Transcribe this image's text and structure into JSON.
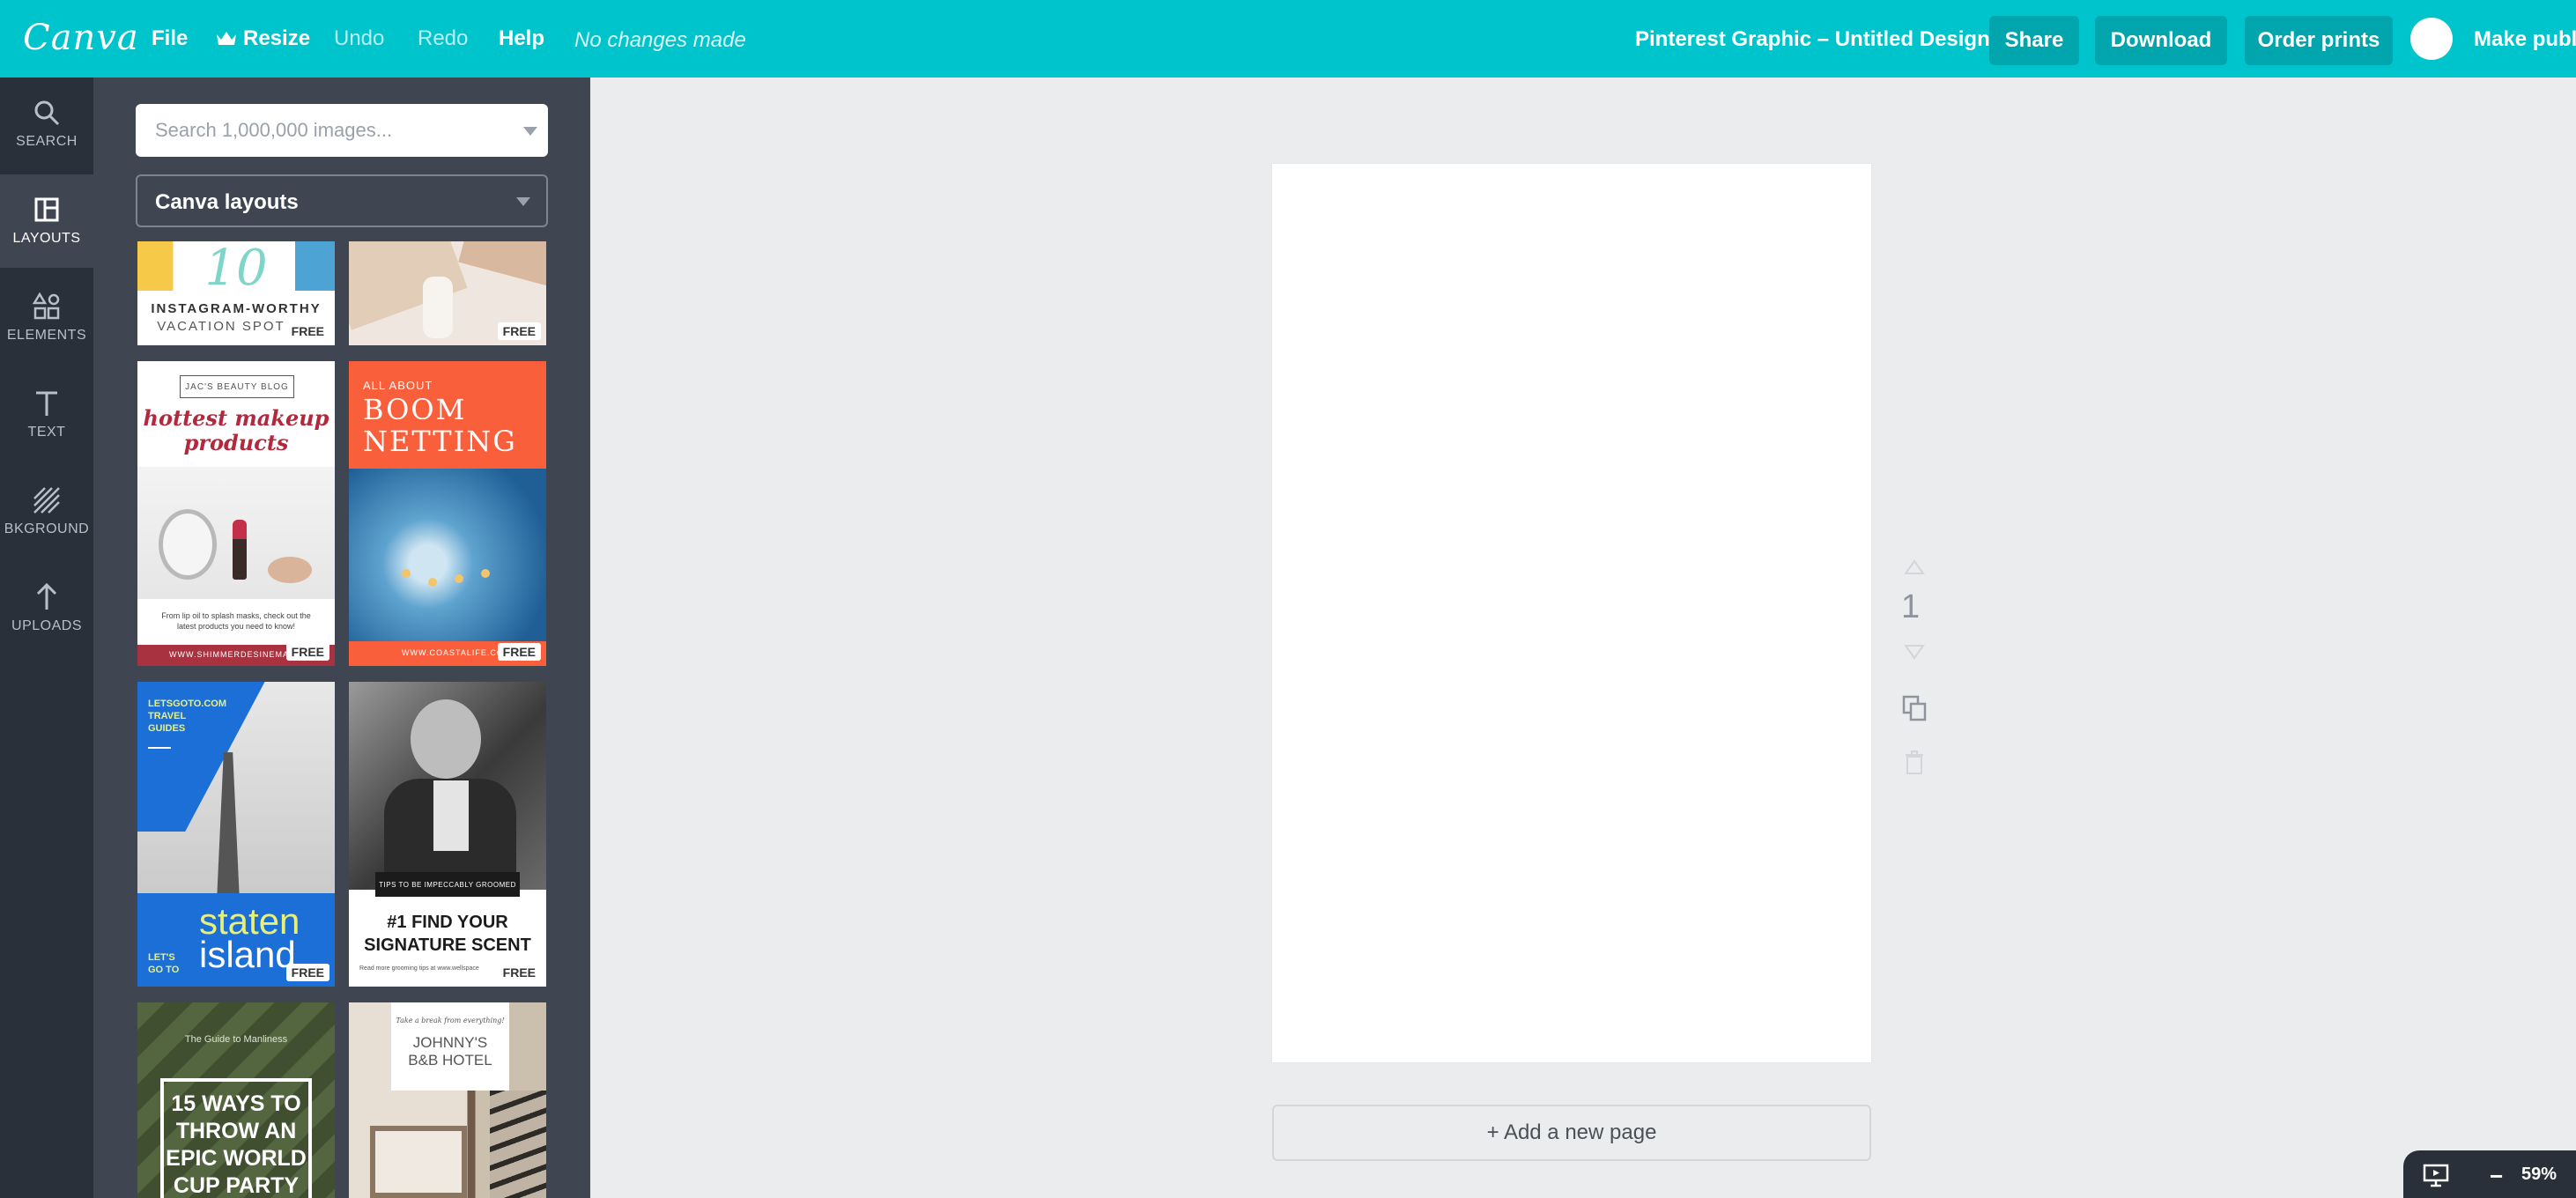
{
  "app": {
    "logo_text": "Canva"
  },
  "menu": {
    "file": "File",
    "resize": "Resize",
    "undo": "Undo",
    "redo": "Redo",
    "help": "Help",
    "status": "No changes made"
  },
  "header": {
    "design_title": "Pinterest Graphic – Untitled Design",
    "share": "Share",
    "download": "Download",
    "order_prints": "Order prints",
    "make_public": "Make publi"
  },
  "sidebar": {
    "items": [
      {
        "label": "SEARCH",
        "icon": "search-icon"
      },
      {
        "label": "LAYOUTS",
        "icon": "layouts-icon"
      },
      {
        "label": "ELEMENTS",
        "icon": "elements-icon"
      },
      {
        "label": "TEXT",
        "icon": "text-icon"
      },
      {
        "label": "BKGROUND",
        "icon": "background-icon"
      },
      {
        "label": "UPLOADS",
        "icon": "upload-icon"
      }
    ]
  },
  "panel": {
    "search_placeholder": "Search 1,000,000 images...",
    "layout_select": "Canva layouts",
    "free_badge": "FREE",
    "thumbs": {
      "vacation": {
        "number": "10",
        "title": "INSTAGRAM-WORTHY",
        "subtitle": "VACATION SPOT"
      },
      "beauty": {
        "blog": "JAC'S BEAUTY BLOG",
        "headline_1": "hottest makeup",
        "headline_2": "products",
        "caption_1": "From lip oil to splash masks, check out the",
        "caption_2": "latest products you need to know!",
        "footer": "WWW.SHIMMERDESINEMAKEUP"
      },
      "netting": {
        "small": "ALL ABOUT",
        "title_1": "BOOM",
        "title_2": "NETTING",
        "footer": "WWW.COASTALIFE.COM"
      },
      "travel": {
        "top_1": "LETSGOTO.COM",
        "top_2": "TRAVEL",
        "top_3": "GUIDES",
        "lets": "LET'S",
        "goto": "GO TO",
        "title_1": "staten",
        "title_2": "island"
      },
      "scent": {
        "tag": "TIPS TO BE IMPECCABLY GROOMED",
        "title_1": "#1 FIND YOUR",
        "title_2": "SIGNATURE SCENT",
        "footer": "Read more grooming tips at www.wellspace"
      },
      "worldcup": {
        "small": "The Guide to Manliness",
        "line_1": "15 WAYS TO",
        "line_2": "THROW AN",
        "line_3": "EPIC WORLD",
        "line_4": "CUP PARTY"
      },
      "hotel": {
        "small": "Take a break from everything!",
        "title_1": "JOHNNY'S",
        "title_2": "B&B HOTEL"
      }
    }
  },
  "canvas": {
    "page_number": "1",
    "add_page": "+ Add a new page",
    "zoom": "59%"
  },
  "colors": {
    "topbar": "#00c4cc",
    "button": "#00a5ad",
    "nav": "#293039",
    "panel": "#3f4652"
  }
}
